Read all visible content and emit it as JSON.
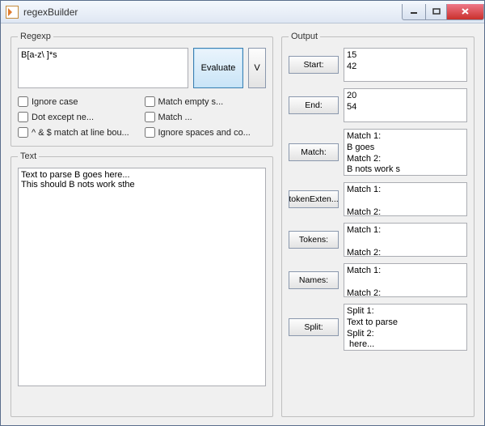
{
  "window": {
    "title": "regexBuilder"
  },
  "regexp": {
    "legend": "Regexp",
    "pattern": "B[a-z\\ ]*s",
    "evaluate_label": "Evaluate",
    "v_label": "V",
    "checks": {
      "ignore_case": "Ignore case",
      "match_empty": "Match empty s...",
      "dot_except": "Dot except ne...",
      "match": "Match ...",
      "anchors": "^ & $ match at line bou...",
      "ignore_spaces": "Ignore spaces and co..."
    }
  },
  "text": {
    "legend": "Text",
    "value": "Text to parse B goes here...\nThis should B nots work sthe"
  },
  "output": {
    "legend": "Output",
    "start": {
      "label": "Start:",
      "value": "15\n42"
    },
    "end": {
      "label": "End:",
      "value": "20\n54"
    },
    "match": {
      "label": "Match:",
      "value": "Match 1:\nB goes\nMatch 2:\nB nots work s"
    },
    "tokenExtents": {
      "label": "tokenExten...",
      "value": "Match 1:\n\nMatch 2:"
    },
    "tokens": {
      "label": "Tokens:",
      "value": "Match 1:\n\nMatch 2:"
    },
    "names": {
      "label": "Names:",
      "value": "Match 1:\n\nMatch 2:"
    },
    "split": {
      "label": "Split:",
      "value": "Split 1:\nText to parse \nSplit 2:\n here..."
    }
  }
}
